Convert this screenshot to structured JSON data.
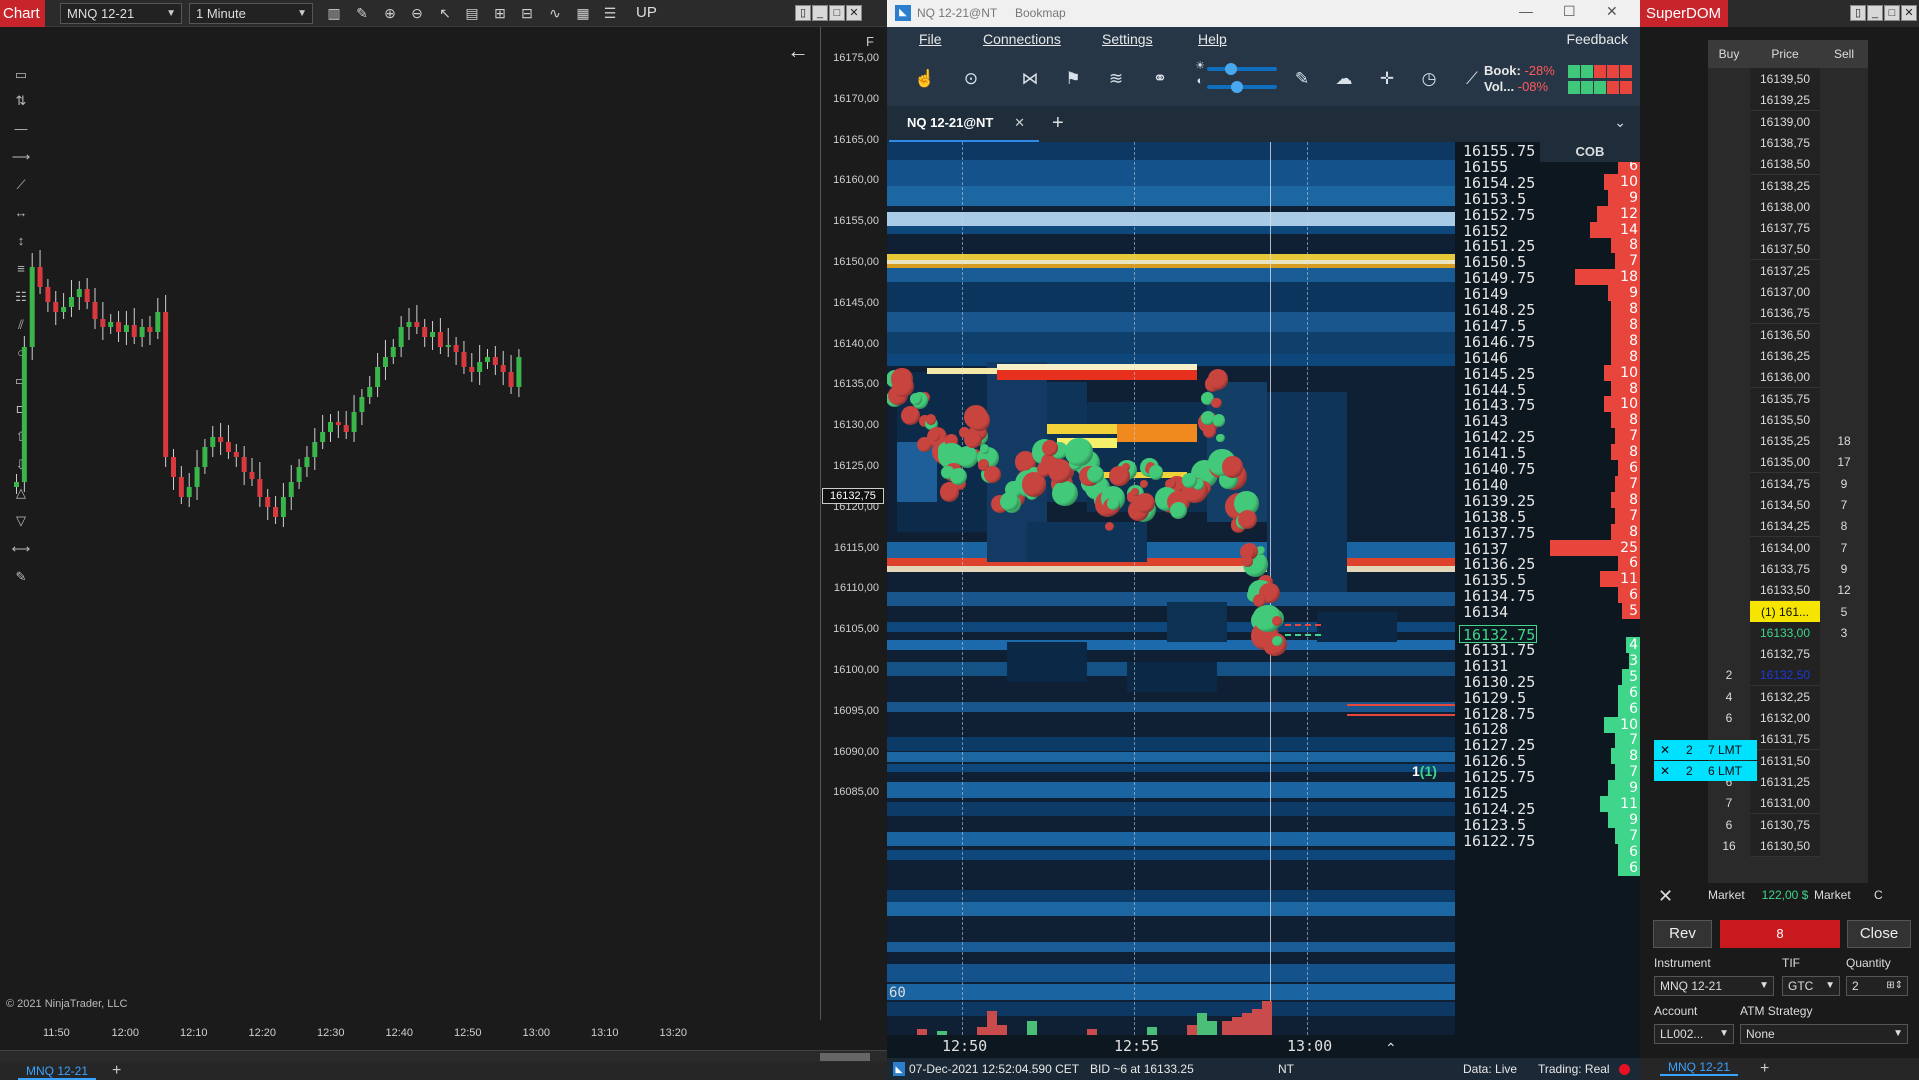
{
  "ninja": {
    "title": "Chart",
    "instrument": "MNQ 12-21",
    "interval": "1 Minute",
    "up_label": "UP",
    "f_label": "F",
    "copyright": "© 2021 NinjaTrader, LLC",
    "current_price": "16132,75",
    "tab": "MNQ 12-21",
    "price_labels": [
      "16175,00",
      "16170,00",
      "16165,00",
      "16160,00",
      "16155,00",
      "16150,00",
      "16145,00",
      "16140,00",
      "16135,00",
      "16130,00",
      "16125,00",
      "16120,00",
      "16115,00",
      "16110,00",
      "16105,00",
      "16100,00",
      "16095,00",
      "16090,00",
      "16085,00"
    ],
    "time_labels": [
      "11:50",
      "12:00",
      "12:10",
      "12:20",
      "12:30",
      "12:40",
      "12:50",
      "13:00",
      "13:10",
      "13:20"
    ],
    "colors": {
      "up": "#39b54a",
      "down": "#d8393f",
      "bg": "#1b1b1b"
    }
  },
  "bookmap": {
    "window_title": "NQ 12-21@NT",
    "app_name": "Bookmap",
    "menu": [
      "File",
      "Connections",
      "Settings",
      "Help"
    ],
    "feedback": "Feedback",
    "book_label": "Book:",
    "book_value": "-28%",
    "vol_label": "Vol...",
    "vol_value": "-08%",
    "tab": "NQ 12-21@NT",
    "cob_header": "COB",
    "scale_label": "60",
    "order_marker": "1",
    "order_marker_paren": "(1)",
    "prices": [
      "16155.75",
      "16155",
      "16154.25",
      "16153.5",
      "16152.75",
      "16152",
      "16151.25",
      "16150.5",
      "16149.75",
      "16149",
      "16148.25",
      "16147.5",
      "16146.75",
      "16146",
      "16145.25",
      "16144.5",
      "16143.75",
      "16143",
      "16142.25",
      "16141.5",
      "16140.75",
      "16140",
      "16139.25",
      "16138.5",
      "16137.75",
      "16137",
      "16136.25",
      "16135.5",
      "16134.75",
      "16134",
      "16132.75",
      "16131.75",
      "16131",
      "16130.25",
      "16129.5",
      "16128.75",
      "16128",
      "16127.25",
      "16126.5",
      "16125.75",
      "16125",
      "16124.25",
      "16123.5",
      "16122.75"
    ],
    "current_price": "16132.75",
    "cob_ask": [
      "8",
      "6",
      "10",
      "9",
      "12",
      "14",
      "8",
      "7",
      "18",
      "9",
      "8",
      "8",
      "8",
      "8",
      "10",
      "8",
      "10",
      "8",
      "7",
      "8",
      "6",
      "7",
      "8",
      "7",
      "8",
      "25",
      "6",
      "11",
      "6",
      "5"
    ],
    "cob_bid": [
      "4",
      "3",
      "5",
      "6",
      "6",
      "10",
      "7",
      "8",
      "7",
      "9",
      "11",
      "9",
      "7",
      "6",
      "6"
    ],
    "time_labels": [
      "12:50",
      "12:55",
      "13:00"
    ],
    "status": {
      "date": "07-Dec-2021 12:52:04.590 CET",
      "bid": "BID ~6 at 16133.25",
      "feed": "NT",
      "data": "Data: Live",
      "trading": "Trading: Real"
    },
    "colors": {
      "bid": "#3fd58a",
      "ask": "#e8453c",
      "accent": "#2d8ae6"
    }
  },
  "superdom": {
    "title": "SuperDOM",
    "headers": {
      "buy": "Buy",
      "price": "Price",
      "sell": "Sell"
    },
    "rows": [
      {
        "buy": "",
        "price": "16139,50",
        "sell": ""
      },
      {
        "buy": "",
        "price": "16139,25",
        "sell": ""
      },
      {
        "buy": "",
        "price": "16139,00",
        "sell": ""
      },
      {
        "buy": "",
        "price": "16138,75",
        "sell": ""
      },
      {
        "buy": "",
        "price": "16138,50",
        "sell": ""
      },
      {
        "buy": "",
        "price": "16138,25",
        "sell": ""
      },
      {
        "buy": "",
        "price": "16138,00",
        "sell": ""
      },
      {
        "buy": "",
        "price": "16137,75",
        "sell": ""
      },
      {
        "buy": "",
        "price": "16137,50",
        "sell": ""
      },
      {
        "buy": "",
        "price": "16137,25",
        "sell": ""
      },
      {
        "buy": "",
        "price": "16137,00",
        "sell": ""
      },
      {
        "buy": "",
        "price": "16136,75",
        "sell": ""
      },
      {
        "buy": "",
        "price": "16136,50",
        "sell": ""
      },
      {
        "buy": "",
        "price": "16136,25",
        "sell": ""
      },
      {
        "buy": "",
        "price": "16136,00",
        "sell": ""
      },
      {
        "buy": "",
        "price": "16135,75",
        "sell": ""
      },
      {
        "buy": "",
        "price": "16135,50",
        "sell": ""
      },
      {
        "buy": "",
        "price": "16135,25",
        "sell": "18"
      },
      {
        "buy": "",
        "price": "16135,00",
        "sell": "17"
      },
      {
        "buy": "",
        "price": "16134,75",
        "sell": "9"
      },
      {
        "buy": "",
        "price": "16134,50",
        "sell": "7"
      },
      {
        "buy": "",
        "price": "16134,25",
        "sell": "8"
      },
      {
        "buy": "",
        "price": "16134,00",
        "sell": "7"
      },
      {
        "buy": "",
        "price": "16133,75",
        "sell": "9"
      },
      {
        "buy": "",
        "price": "16133,50",
        "sell": "12"
      },
      {
        "buy": "",
        "price": "(1) 161...",
        "sell": "5"
      },
      {
        "buy": "",
        "price": "16133,00",
        "sell": "3"
      },
      {
        "buy": "",
        "price": "16132,75",
        "sell": ""
      },
      {
        "buy": "2",
        "price": "16132,50",
        "sell": ""
      },
      {
        "buy": "4",
        "price": "16132,25",
        "sell": ""
      },
      {
        "buy": "6",
        "price": "16132,00",
        "sell": ""
      },
      {
        "buy": "",
        "price": "16131,75",
        "sell": ""
      },
      {
        "buy": "",
        "price": "16131,50",
        "sell": ""
      },
      {
        "buy": "6",
        "price": "16131,25",
        "sell": ""
      },
      {
        "buy": "7",
        "price": "16131,00",
        "sell": ""
      },
      {
        "buy": "6",
        "price": "16130,75",
        "sell": ""
      },
      {
        "buy": "16",
        "price": "16130,50",
        "sell": ""
      }
    ],
    "lmt_orders": [
      {
        "x": "✕",
        "qty": "2",
        "label": "7 LMT",
        "price": "16131,75"
      },
      {
        "x": "✕",
        "qty": "2",
        "label": "6 LMT",
        "price": "16131,50"
      }
    ],
    "market_left": "Market",
    "pnl": "122,00 $",
    "market_right": "Market",
    "c_label": "C",
    "rev": "Rev",
    "position": "8",
    "close": "Close",
    "instrument_label": "Instrument",
    "tif_label": "TIF",
    "quantity_label": "Quantity",
    "instrument": "MNQ 12-21",
    "tif": "GTC",
    "quantity": "2",
    "account_label": "Account",
    "atm_label": "ATM Strategy",
    "account": "LL002...",
    "atm": "None",
    "tab": "MNQ 12-21"
  }
}
